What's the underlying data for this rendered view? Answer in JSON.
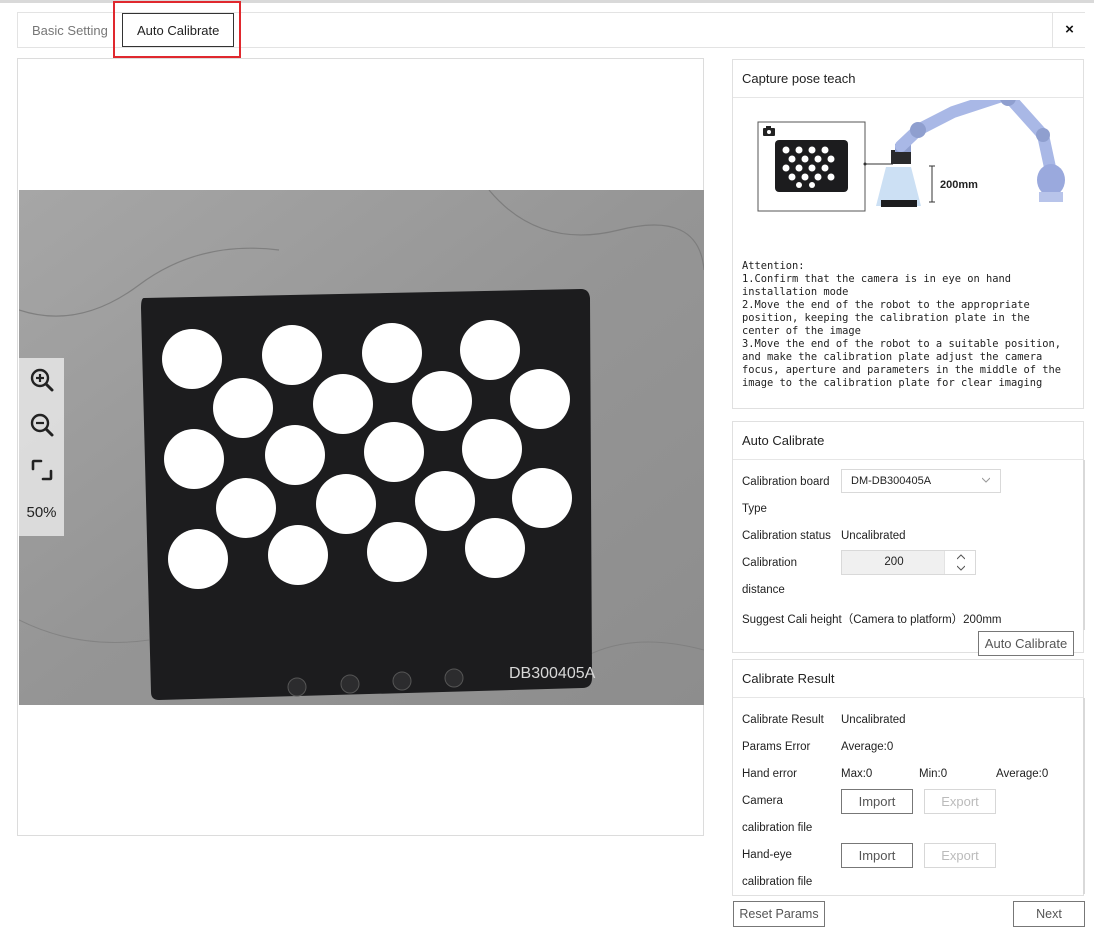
{
  "tabs": [
    {
      "label": "Basic Setting",
      "active": false
    },
    {
      "label": "Auto Calibrate",
      "active": true
    }
  ],
  "close_icon": "×",
  "viewer": {
    "zoom_level": "50%",
    "board_marking": "DB300405A",
    "tools": [
      "zoom-in-icon",
      "zoom-out-icon",
      "fit-screen-icon"
    ]
  },
  "capture_pose": {
    "title": "Capture pose teach",
    "distance_label": "200mm",
    "attention": "Attention:\n1.Confirm that the camera is in eye on hand\ninstallation mode\n2.Move the end of the robot to the appropriate\nposition, keeping the calibration plate in the\ncenter of the image\n3.Move the end of the robot to a suitable position,\nand make the calibration plate adjust the camera\nfocus, aperture and parameters in the middle of the\nimage to the calibration plate for clear imaging"
  },
  "auto_calibrate": {
    "title": "Auto Calibrate",
    "board_type_label_1": "Calibration board",
    "board_type_label_2": "Type",
    "board_type_value": "DM-DB300405A",
    "status_label": "Calibration status",
    "status_value": "Uncalibrated",
    "distance_label_1": "Calibration",
    "distance_label_2": "distance",
    "distance_value": "200",
    "suggest_label": "Suggest Cali height（Camera to platform）200mm",
    "button_label": "Auto Calibrate"
  },
  "calibrate_result": {
    "title": "Calibrate Result",
    "result_label": "Calibrate Result",
    "result_value": "Uncalibrated",
    "params_error_label": "Params Error",
    "params_error_value": "Average:0",
    "hand_error_label": "Hand error",
    "hand_error_max": "Max:0",
    "hand_error_min": "Min:0",
    "hand_error_avg": "Average:0",
    "camera_file_label_1": "Camera",
    "camera_file_label_2": "calibration file",
    "handeye_file_label_1": "Hand-eye",
    "handeye_file_label_2": "calibration file",
    "import_label": "Import",
    "export_label": "Export"
  },
  "footer": {
    "reset_label": "Reset Params",
    "next_label": "Next"
  },
  "colors": {
    "highlight": "#e0282e",
    "board": "#1c1c1e",
    "robot": "#a9b8e6"
  }
}
